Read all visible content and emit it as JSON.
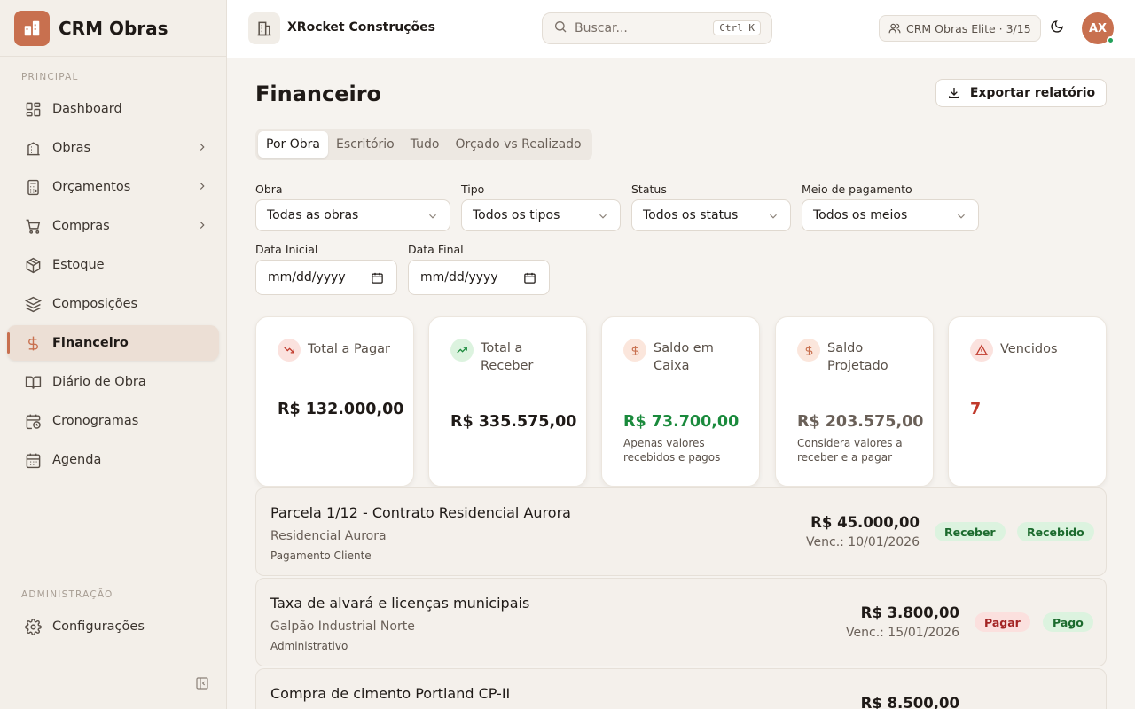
{
  "brand": {
    "name": "CRM Obras"
  },
  "sidebar": {
    "section_principal": "PRINCIPAL",
    "section_admin": "ADMINISTRAÇÃO",
    "items": [
      {
        "label": "Dashboard",
        "icon": "layout-grid-icon"
      },
      {
        "label": "Obras",
        "icon": "building-icon"
      },
      {
        "label": "Orçamentos",
        "icon": "calculator-icon"
      },
      {
        "label": "Compras",
        "icon": "shopping-cart-icon"
      },
      {
        "label": "Estoque",
        "icon": "package-icon"
      },
      {
        "label": "Composições",
        "icon": "layers-icon"
      },
      {
        "label": "Financeiro",
        "icon": "dollar-icon"
      },
      {
        "label": "Diário de Obra",
        "icon": "book-open-icon"
      },
      {
        "label": "Cronogramas",
        "icon": "calendar-clock-icon"
      },
      {
        "label": "Agenda",
        "icon": "calendar-icon"
      }
    ],
    "admin_items": [
      {
        "label": "Configurações",
        "icon": "gear-icon"
      }
    ]
  },
  "header": {
    "company": "XRocket Construções",
    "search_placeholder": "Buscar...",
    "search_shortcut": "Ctrl K",
    "plan": "CRM Obras Elite · 3/15",
    "avatar_initials": "AX"
  },
  "page": {
    "title": "Financeiro",
    "export_label": "Exportar relatório",
    "tabs": [
      "Por Obra",
      "Escritório",
      "Tudo",
      "Orçado vs Realizado"
    ],
    "active_tab": "Por Obra"
  },
  "filters": {
    "obra": {
      "label": "Obra",
      "value": "Todas as obras"
    },
    "tipo": {
      "label": "Tipo",
      "value": "Todos os tipos"
    },
    "status": {
      "label": "Status",
      "value": "Todos os status"
    },
    "meio": {
      "label": "Meio de pagamento",
      "value": "Todos os meios"
    },
    "data_inicial": {
      "label": "Data Inicial",
      "value": "mm/dd/yyyy"
    },
    "data_final": {
      "label": "Data Final",
      "value": "mm/dd/yyyy"
    }
  },
  "cards": [
    {
      "title": "Total a Pagar",
      "value": "R$ 132.000,00",
      "note": "",
      "color": "#1f1a17"
    },
    {
      "title": "Total a Receber",
      "value": "R$ 335.575,00",
      "note": "",
      "color": "#1f1a17"
    },
    {
      "title": "Saldo em Caixa",
      "value": "R$ 73.700,00",
      "note": "Apenas valores recebidos e pagos",
      "color": "#1a8a3c"
    },
    {
      "title": "Saldo Projetado",
      "value": "R$ 203.575,00",
      "note": "Considera valores a receber e a pagar",
      "color": "#6a6058"
    },
    {
      "title": "Vencidos",
      "value": "7",
      "note": "",
      "color": "#c0392b"
    }
  ],
  "transactions": [
    {
      "title": "Parcela 1/12 - Contrato Residencial Aurora",
      "obra": "Residencial Aurora",
      "categoria": "Pagamento Cliente",
      "valor": "R$ 45.000,00",
      "vencimento": "Venc.: 10/01/2026",
      "tipo": "Receber",
      "status": "Recebido"
    },
    {
      "title": "Taxa de alvará e licenças municipais",
      "obra": "Galpão Industrial Norte",
      "categoria": "Administrativo",
      "valor": "R$ 3.800,00",
      "vencimento": "Venc.: 15/01/2026",
      "tipo": "Pagar",
      "status": "Pago"
    },
    {
      "title": "Compra de cimento Portland CP-II",
      "obra": "",
      "categoria": "",
      "valor": "R$ 8.500,00",
      "vencimento": "",
      "tipo": "",
      "status": ""
    }
  ]
}
